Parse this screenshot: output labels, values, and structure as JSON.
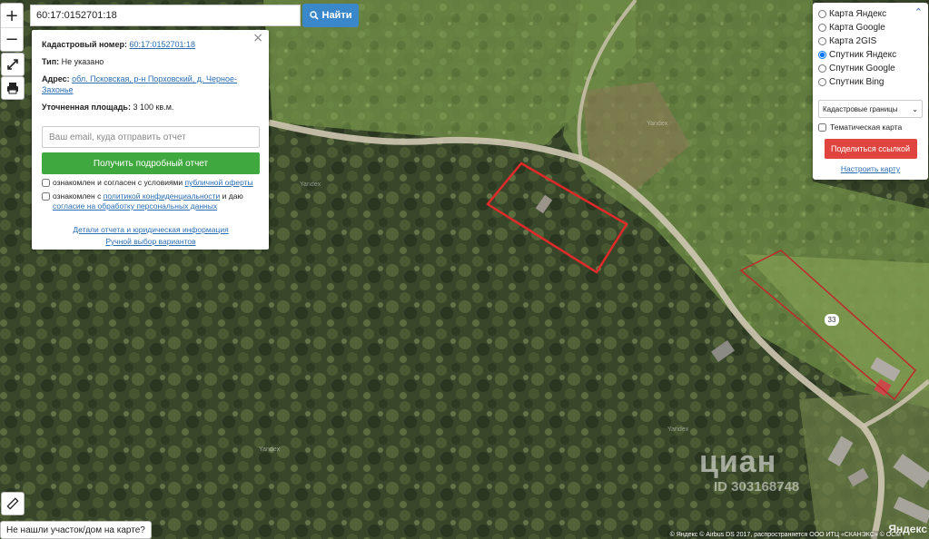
{
  "search": {
    "value": "60:17:0152701:18",
    "button_label": "Найти"
  },
  "zoom": {
    "in": "+",
    "out": "−"
  },
  "info_card": {
    "cadastral_label": "Кадастровый номер:",
    "cadastral_value": "60:17:0152701:18",
    "type_label": "Тип:",
    "type_value": "Не указано",
    "address_label": "Адрес:",
    "address_value": "обл. Псковская, р-н Порховский, д. Черное-Захонье",
    "area_label": "Уточненная площадь:",
    "area_value": "3 100 кв.м.",
    "email_placeholder": "Ваш email, куда отправить отчет",
    "report_button": "Получить подробный отчет",
    "consent1_text": "ознакомлен и согласен с условиями",
    "consent1_link": "публичной оферты",
    "consent2_text1": "ознакомлен с",
    "consent2_link1": "политикой конфиденциальности",
    "consent2_text2": "и даю",
    "consent2_link2": "согласие на обработку персональных данных",
    "link_details": "Детали отчета и юридическая информация",
    "link_manual": "Ручной выбор вариантов"
  },
  "layers": {
    "options": [
      {
        "label": "Карта Яндекс",
        "checked": false
      },
      {
        "label": "Карта Google",
        "checked": false
      },
      {
        "label": "Карта 2GIS",
        "checked": false
      },
      {
        "label": "Спутник Яндекс",
        "checked": true
      },
      {
        "label": "Спутник Google",
        "checked": false
      },
      {
        "label": "Спутник Bing",
        "checked": false
      }
    ],
    "select_value": "Кадастровые границы",
    "thematic_label": "Тематическая карта",
    "share_button": "Поделиться ссылкой",
    "setup_link": "Настроить карту"
  },
  "bottom": {
    "not_found": "Не нашли участок/дом на карте?",
    "copyright": "© Яндекс © Airbus DS 2017, распространяется ООО ИТЦ «СКАНЭКС» © ОСМ",
    "yandex": "Яндекс"
  },
  "map_labels": {
    "house_number": "33",
    "watermark": "циан",
    "watermark_id": "ID 303168748",
    "yandex_1": "Yandex",
    "yandex_2": "Yandex",
    "yandex_3": "Yandex",
    "yandex_4": "Yandex"
  },
  "colors": {
    "parcel_border": "#e02a2a",
    "accent_blue": "#3a87c9",
    "green_button": "#3fa83f",
    "share_red": "#e0443e"
  }
}
